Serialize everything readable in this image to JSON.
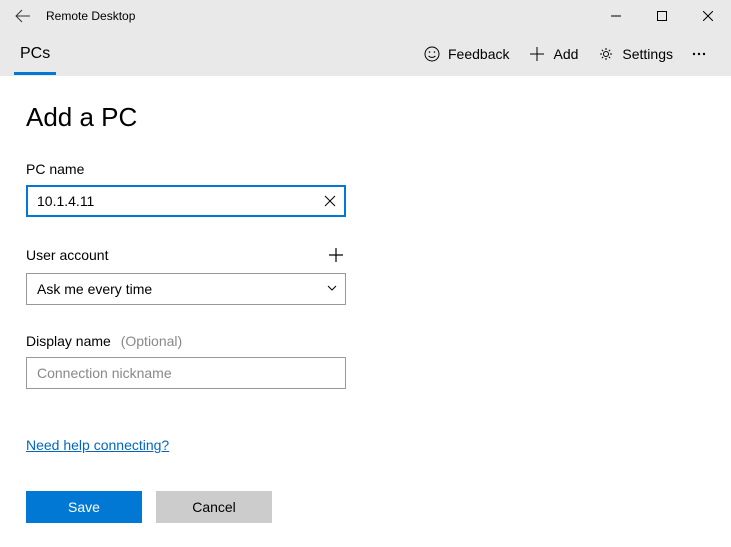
{
  "window": {
    "title": "Remote Desktop"
  },
  "toolbar": {
    "tab_pcs": "PCs",
    "feedback": "Feedback",
    "add": "Add",
    "settings": "Settings"
  },
  "page": {
    "heading": "Add a PC"
  },
  "fields": {
    "pc_name": {
      "label": "PC name",
      "value": "10.1.4.11"
    },
    "user_account": {
      "label": "User account",
      "value": "Ask me every time"
    },
    "display_name": {
      "label": "Display name",
      "optional": "(Optional)",
      "placeholder": "Connection nickname",
      "value": ""
    }
  },
  "help_link": "Need help connecting?",
  "buttons": {
    "save": "Save",
    "cancel": "Cancel"
  }
}
